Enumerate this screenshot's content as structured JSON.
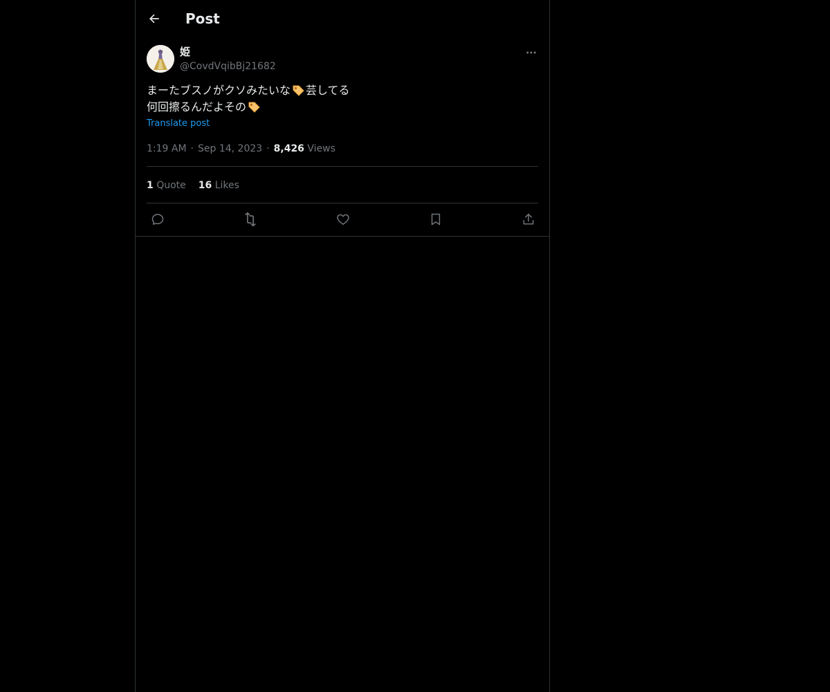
{
  "header": {
    "title": "Post",
    "back_icon": "arrow-left-icon"
  },
  "post": {
    "author": {
      "display_name": "姫",
      "handle": "@CovdVqibBj21682"
    },
    "text_lines": [
      {
        "before": "まーたブスノがクソみたいな",
        "emoji": "label-tag-emoji",
        "after": "芸してる"
      },
      {
        "before": "何回擦るんだよその",
        "emoji": "label-tag-emoji",
        "after": ""
      }
    ],
    "translate_label": "Translate post",
    "time": "1:19 AM",
    "date": "Sep 14, 2023",
    "separator": "·",
    "views_count": "8,426",
    "views_label": "Views",
    "stats": {
      "quotes_count": "1",
      "quotes_label": "Quote",
      "likes_count": "16",
      "likes_label": "Likes"
    },
    "actions": [
      "reply-icon",
      "repost-icon",
      "like-icon",
      "bookmark-icon",
      "share-icon"
    ]
  },
  "colors": {
    "background": "#000000",
    "text_primary": "#e7e9ea",
    "text_secondary": "#71767b",
    "link": "#1d9bf0",
    "border": "#2f3336"
  }
}
